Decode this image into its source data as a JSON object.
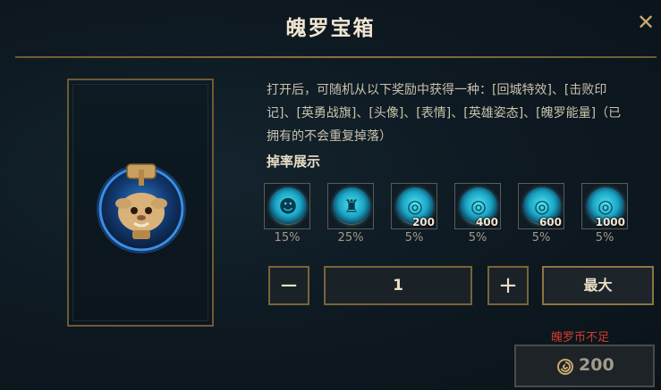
{
  "dialog": {
    "title": "魄罗宝箱",
    "close_label": "✕"
  },
  "description": "打开后，可随机从以下奖励中获得一种：[回城特效]、[击败印记]、[英勇战旗]、[头像]、[表情]、[英雄姿态]、[魄罗能量]（已拥有的不会重复掉落）",
  "drop_rates": {
    "title": "掉率展示",
    "items": [
      {
        "icon": "emote-smile-icon",
        "glyph": "☻",
        "amount": "",
        "rate": "15%"
      },
      {
        "icon": "champion-pose-icon",
        "glyph": "♜",
        "amount": "",
        "rate": "25%"
      },
      {
        "icon": "poro-energy-icon",
        "glyph": "◎",
        "amount": "200",
        "rate": "5%"
      },
      {
        "icon": "poro-energy-icon",
        "glyph": "◎",
        "amount": "400",
        "rate": "5%"
      },
      {
        "icon": "poro-energy-icon",
        "glyph": "◎",
        "amount": "600",
        "rate": "5%"
      },
      {
        "icon": "poro-energy-icon",
        "glyph": "◎",
        "amount": "1000",
        "rate": "5%"
      }
    ]
  },
  "quantity": {
    "minus_label": "−",
    "value": "1",
    "plus_label": "+",
    "max_label": "最大"
  },
  "purchase": {
    "warning": "魄罗币不足",
    "price": "200",
    "currency_icon": "poro-coin-icon"
  },
  "colors": {
    "gold": "#c8aa6e",
    "warning_red": "#d03a32",
    "cyan": "#1ba4c4"
  }
}
